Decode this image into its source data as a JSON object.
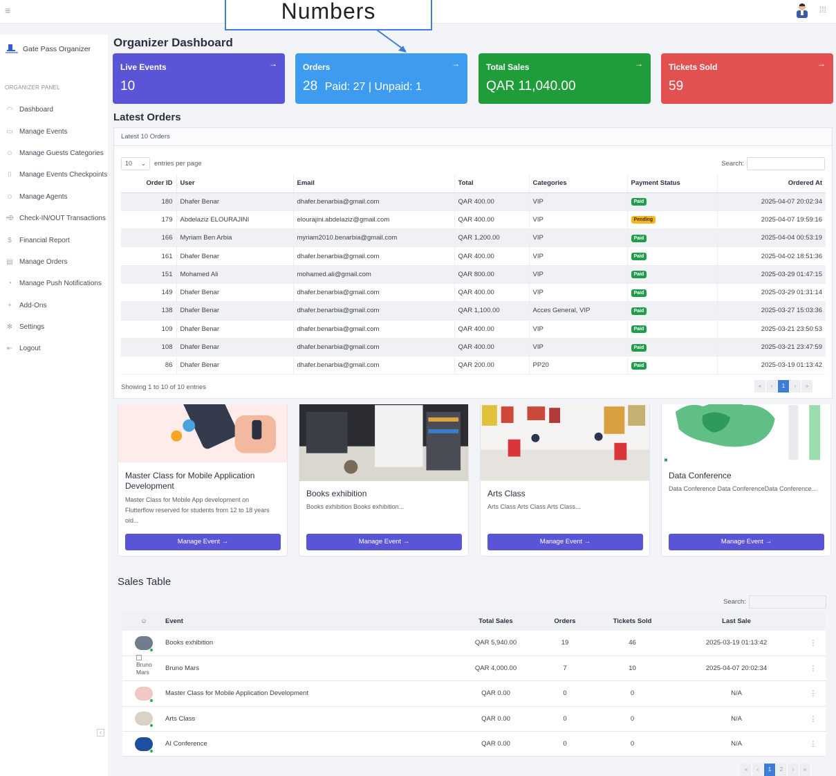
{
  "topbar": {
    "callout_text": "Numbers"
  },
  "sidebar": {
    "brand": "Gate Pass Organizer",
    "panel_title": "ORGANIZER PANEL",
    "items": [
      {
        "label": "Dashboard",
        "icon": "dashboard-icon",
        "glyph": "◠"
      },
      {
        "label": "Manage Events",
        "icon": "calendar-icon",
        "glyph": "▭"
      },
      {
        "label": "Manage Guests Categories",
        "icon": "users-icon",
        "glyph": "☺"
      },
      {
        "label": "Manage Events Checkpoints",
        "icon": "checkpoint-icon",
        "glyph": "⌷"
      },
      {
        "label": "Manage Agents",
        "icon": "agents-icon",
        "glyph": "☺"
      },
      {
        "label": "Check-IN/OUT Transactions",
        "icon": "tag-icon",
        "glyph": "⬲"
      },
      {
        "label": "Financial Report",
        "icon": "dollar-icon",
        "glyph": "$"
      },
      {
        "label": "Manage Orders",
        "icon": "printer-icon",
        "glyph": "▤"
      },
      {
        "label": "Manage Push Notifications",
        "icon": "bell-icon",
        "glyph": "◔"
      },
      {
        "label": "Add-Ons",
        "icon": "plus-icon",
        "glyph": "+"
      },
      {
        "label": "Settings",
        "icon": "gear-icon",
        "glyph": "✻"
      },
      {
        "label": "Logout",
        "icon": "logout-icon",
        "glyph": "⇤"
      }
    ]
  },
  "main": {
    "title": "Organizer Dashboard",
    "cards": [
      {
        "title": "Live Events",
        "value": "10",
        "extra": "",
        "color": "#5a55d6"
      },
      {
        "title": "Orders",
        "value": "28",
        "extra": "Paid: 27 | Unpaid: 1",
        "color": "#3d9cf0"
      },
      {
        "title": "Total Sales",
        "value": "QAR 11,040.00",
        "extra": "",
        "color": "#1f9d3a"
      },
      {
        "title": "Tickets Sold",
        "value": "59",
        "extra": "",
        "color": "#e35050"
      }
    ],
    "arrow_glyph": "→"
  },
  "latest_orders": {
    "title": "Latest Orders",
    "subtitle": "Latest 10 Orders",
    "page_length": "10",
    "entries_label": "entries per page",
    "search_label": "Search:",
    "columns": [
      "Order ID",
      "User",
      "Email",
      "Total",
      "Categories",
      "Payment Status",
      "Ordered At"
    ],
    "rows": [
      {
        "id": "180",
        "user": "Dhafer Benar",
        "email": "dhafer.benarbia@gmail.com",
        "total": "QAR 400.00",
        "categories": "VIP",
        "status": "Paid",
        "at": "2025-04-07 20:02:34"
      },
      {
        "id": "179",
        "user": "Abdelaziz ELOURAJINI",
        "email": "elourajini.abdelaziz@gmail.com",
        "total": "QAR 400.00",
        "categories": "VIP",
        "status": "Pending",
        "at": "2025-04-07 19:59:16"
      },
      {
        "id": "166",
        "user": "Myriam Ben Arbia",
        "email": "myriam2010.benarbia@gmail.com",
        "total": "QAR 1,200.00",
        "categories": "VIP",
        "status": "Paid",
        "at": "2025-04-04 00:53:19"
      },
      {
        "id": "161",
        "user": "Dhafer Benar",
        "email": "dhafer.benarbia@gmail.com",
        "total": "QAR 400.00",
        "categories": "VIP",
        "status": "Paid",
        "at": "2025-04-02 18:51:36"
      },
      {
        "id": "151",
        "user": "Mohamed Ali",
        "email": "mohamed.ali@gmail.com",
        "total": "QAR 800.00",
        "categories": "VIP",
        "status": "Paid",
        "at": "2025-03-29 01:47:15"
      },
      {
        "id": "149",
        "user": "Dhafer Benar",
        "email": "dhafer.benarbia@gmail.com",
        "total": "QAR 400.00",
        "categories": "VIP",
        "status": "Paid",
        "at": "2025-03-29 01:31:14"
      },
      {
        "id": "138",
        "user": "Dhafer Benar",
        "email": "dhafer.benarbia@gmail.com",
        "total": "QAR 1,100.00",
        "categories": "Acces General, VIP",
        "status": "Paid",
        "at": "2025-03-27 15:03:36"
      },
      {
        "id": "109",
        "user": "Dhafer Benar",
        "email": "dhafer.benarbia@gmail.com",
        "total": "QAR 400.00",
        "categories": "VIP",
        "status": "Paid",
        "at": "2025-03-21 23:50:53"
      },
      {
        "id": "108",
        "user": "Dhafer Benar",
        "email": "dhafer.benarbia@gmail.com",
        "total": "QAR 400.00",
        "categories": "VIP",
        "status": "Paid",
        "at": "2025-03-21 23:47:59"
      },
      {
        "id": "86",
        "user": "Dhafer Benar",
        "email": "dhafer.benarbia@gmail.com",
        "total": "QAR 200.00",
        "categories": "PP20",
        "status": "Paid",
        "at": "2025-03-19 01:13:42"
      }
    ],
    "showing": "Showing 1 to 10 of 10 entries",
    "pager": [
      "«",
      "‹",
      "1",
      "›",
      "»"
    ]
  },
  "events": [
    {
      "title": "Master Class for Mobile Application Development",
      "desc": "Master Class for Mobile App development on Flutterflow reserved for students from 12 to 18 years old...",
      "button": "Manage Event →"
    },
    {
      "title": "Books exhibition",
      "desc": "Books exhibition Books exhibition...",
      "button": "Manage Event →"
    },
    {
      "title": "Arts Class",
      "desc": "Arts Class Arts Class Arts Class...",
      "button": "Manage Event →"
    },
    {
      "title": "Data Conference",
      "desc": "Data Conference Data ConferenceData Conference...",
      "button": "Manage Event →"
    }
  ],
  "sales_table": {
    "title": "Sales Table",
    "search_label": "Search:",
    "columns": [
      "Event",
      "Total Sales",
      "Orders",
      "Tickets Sold",
      "Last Sale"
    ],
    "rows": [
      {
        "event": "Books exhibition",
        "total": "QAR 5,940.00",
        "orders": "19",
        "tickets": "46",
        "last": "2025-03-19 01:13:42",
        "thumb": "#6f7d8c",
        "alt": ""
      },
      {
        "event": "Bruno Mars",
        "total": "QAR 4,000.00",
        "orders": "7",
        "tickets": "10",
        "last": "2025-04-07 20:02:34",
        "thumb": "",
        "alt": "Bruno Mars"
      },
      {
        "event": "Master Class for Mobile Application Development",
        "total": "QAR 0.00",
        "orders": "0",
        "tickets": "0",
        "last": "N/A",
        "thumb": "#f1c9c4",
        "alt": ""
      },
      {
        "event": "Arts Class",
        "total": "QAR 0.00",
        "orders": "0",
        "tickets": "0",
        "last": "N/A",
        "thumb": "#d8d2c8",
        "alt": ""
      },
      {
        "event": "AI Conference",
        "total": "QAR 0.00",
        "orders": "0",
        "tickets": "0",
        "last": "N/A",
        "thumb": "#1f4fa0",
        "alt": ""
      }
    ],
    "pager": [
      "«",
      "‹",
      "1",
      "2",
      "›",
      "»"
    ]
  }
}
